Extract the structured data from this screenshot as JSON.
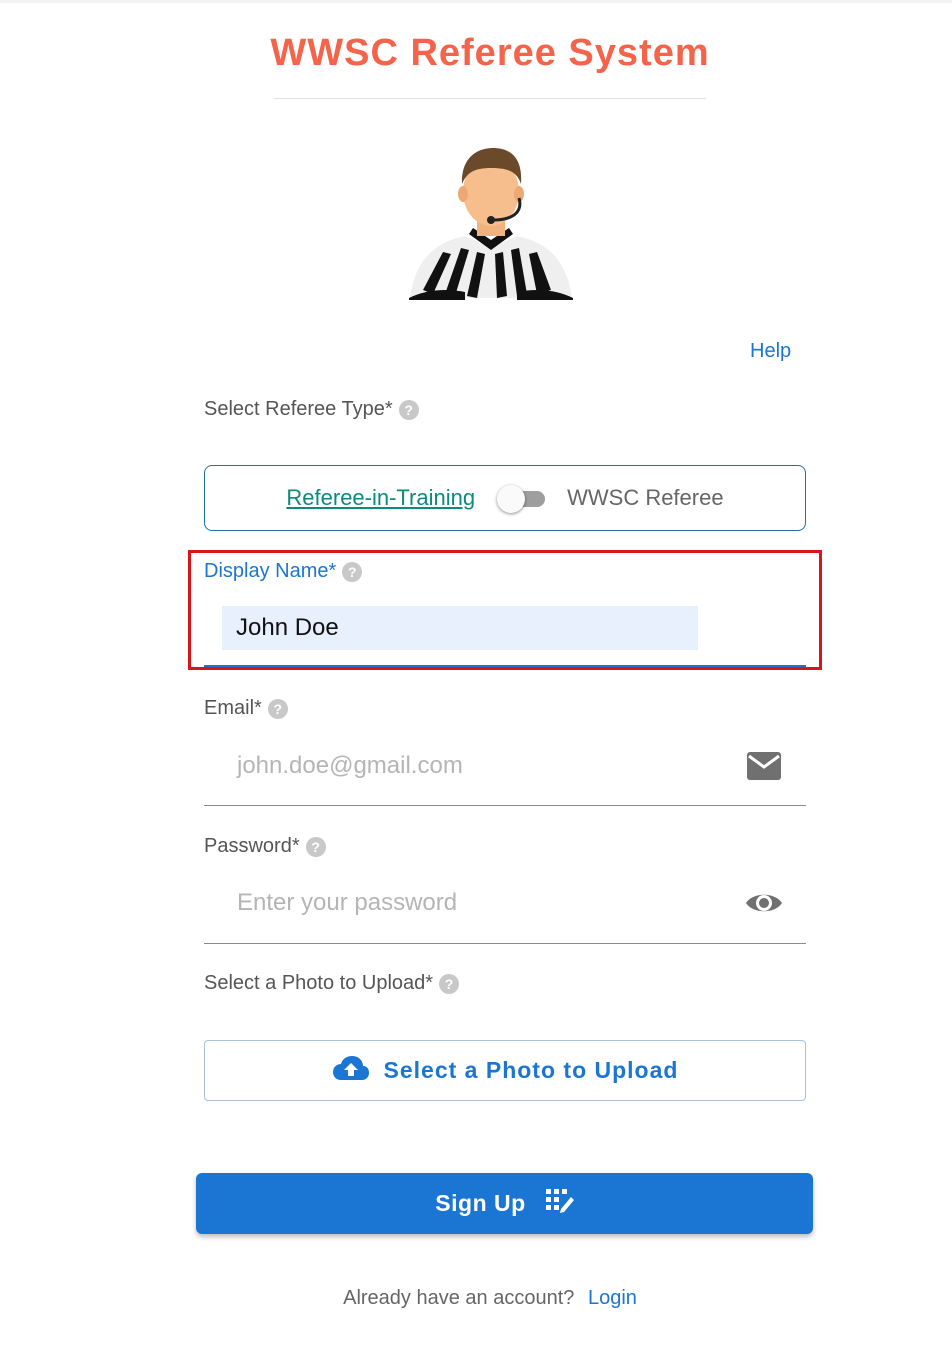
{
  "header": {
    "title": "WWSC Referee System"
  },
  "avatar": {
    "icon": "referee-avatar-icon"
  },
  "help": {
    "label": "Help"
  },
  "referee_type": {
    "label": "Select Referee Type*",
    "option_left": "Referee-in-Training",
    "option_right": "WWSC Referee",
    "toggle_on": false
  },
  "display_name": {
    "label": "Display Name*",
    "value": "John Doe"
  },
  "email": {
    "label": "Email*",
    "placeholder": "john.doe@gmail.com",
    "icon": "mail-icon"
  },
  "password": {
    "label": "Password*",
    "placeholder": "Enter your password",
    "icon": "eye-icon"
  },
  "photo": {
    "label": "Select a Photo to Upload*",
    "button_label": "Select a Photo to Upload",
    "icon": "cloud-upload-icon"
  },
  "signup": {
    "label": "Sign Up",
    "icon": "register-icon"
  },
  "footer": {
    "prompt": "Already have an account?",
    "login_label": "Login"
  },
  "colors": {
    "title": "#f4644a",
    "primary": "#1a76d2",
    "highlight": "#d9141b",
    "toggle_text": "#0b8a7d"
  }
}
